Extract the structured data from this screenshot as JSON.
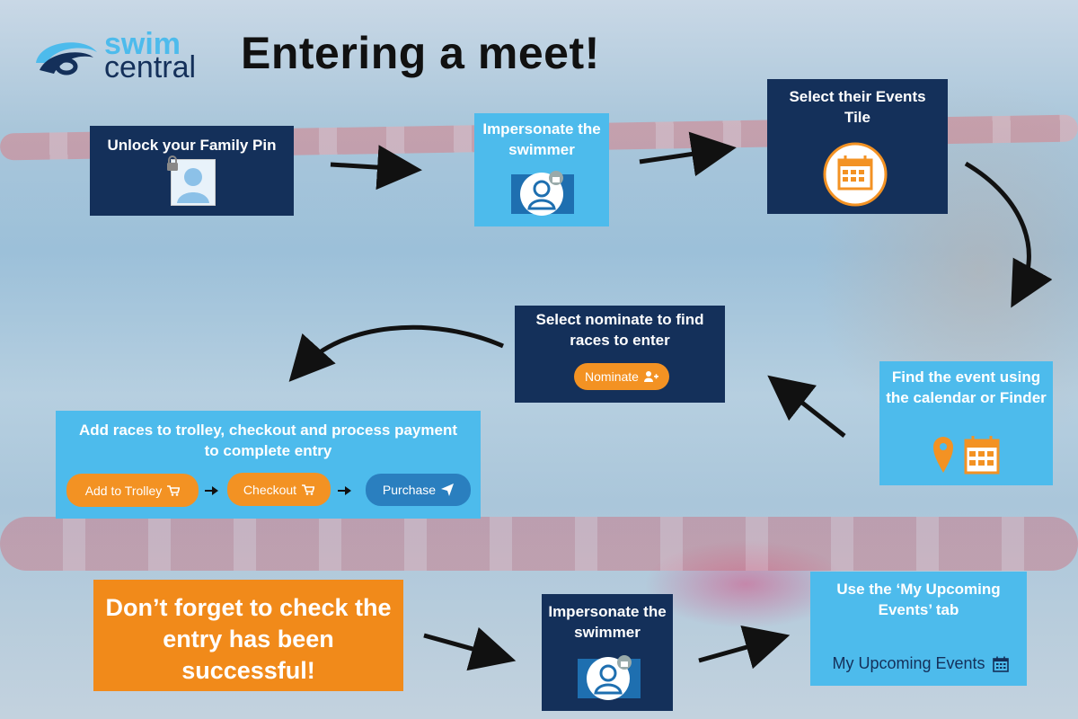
{
  "logo": {
    "line1": "swim",
    "line2": "central"
  },
  "title": "Entering a meet!",
  "steps": {
    "unlock": {
      "label": "Unlock your Family Pin"
    },
    "impersonate1": {
      "label": "Impersonate the swimmer"
    },
    "select_events": {
      "label": "Select their Events Tile"
    },
    "find_event": {
      "label": "Find the event using the calendar or Finder"
    },
    "nominate": {
      "label": "Select nominate to find races to enter",
      "button": "Nominate"
    },
    "trolley": {
      "label": "Add races to trolley, checkout and  process payment to complete entry",
      "buttons": {
        "add": "Add to Trolley",
        "checkout": "Checkout",
        "purchase": "Purchase"
      }
    },
    "reminder": {
      "label": "Don’t forget to check the entry has been successful!"
    },
    "impersonate2": {
      "label": "Impersonate the swimmer"
    },
    "upcoming": {
      "label": "Use the ‘My Upcoming Events’ tab",
      "tab": "My Upcoming Events"
    }
  },
  "colors": {
    "dark_box": "#14305a",
    "light_box": "#4dbbec",
    "orange_box": "#f18a1a",
    "orange_button": "#f39223",
    "blue_button": "#2a7fbf",
    "calendar_icon": "#f39223"
  },
  "icons": [
    "padlock-icon",
    "avatar-icon",
    "impersonate-icon",
    "calendar-icon",
    "location-pin-icon",
    "user-plus-icon",
    "cart-icon",
    "paper-plane-icon"
  ]
}
